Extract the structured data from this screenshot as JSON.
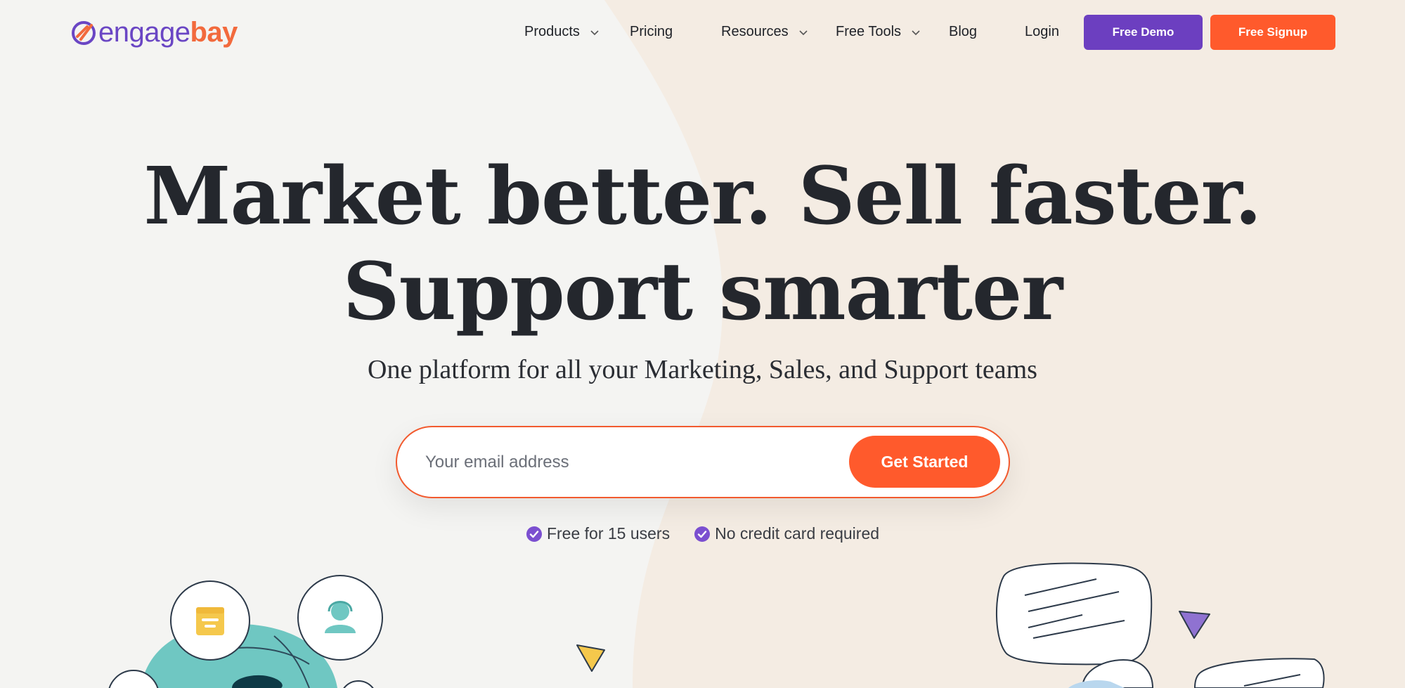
{
  "brand": {
    "name_part1": "engage",
    "name_part2": "bay",
    "colors": {
      "purple": "#6c3fc0",
      "orange": "#ff5a2c"
    }
  },
  "nav": {
    "items": [
      {
        "label": "Products",
        "has_dropdown": true
      },
      {
        "label": "Pricing",
        "has_dropdown": false
      },
      {
        "label": "Resources",
        "has_dropdown": true
      },
      {
        "label": "Free Tools",
        "has_dropdown": true
      },
      {
        "label": "Blog",
        "has_dropdown": false
      },
      {
        "label": "Login",
        "has_dropdown": false
      }
    ],
    "demo_label": "Free Demo",
    "signup_label": "Free Signup"
  },
  "hero": {
    "title_line1": "Market better. Sell faster.",
    "title_line2": "Support smarter",
    "subtitle": "One platform for all your Marketing, Sales, and Support teams",
    "email_placeholder": "Your email address",
    "cta_label": "Get Started",
    "perks": [
      "Free for 15 users",
      "No credit card required"
    ]
  },
  "icons": {
    "logo": "engagebay-logo-icon",
    "chevron": "chevron-down-icon",
    "check": "check-circle-icon",
    "illustrations": [
      "document-icon",
      "support-agent-icon",
      "chat-bubble-icon",
      "triangle-decoration-icon"
    ]
  }
}
